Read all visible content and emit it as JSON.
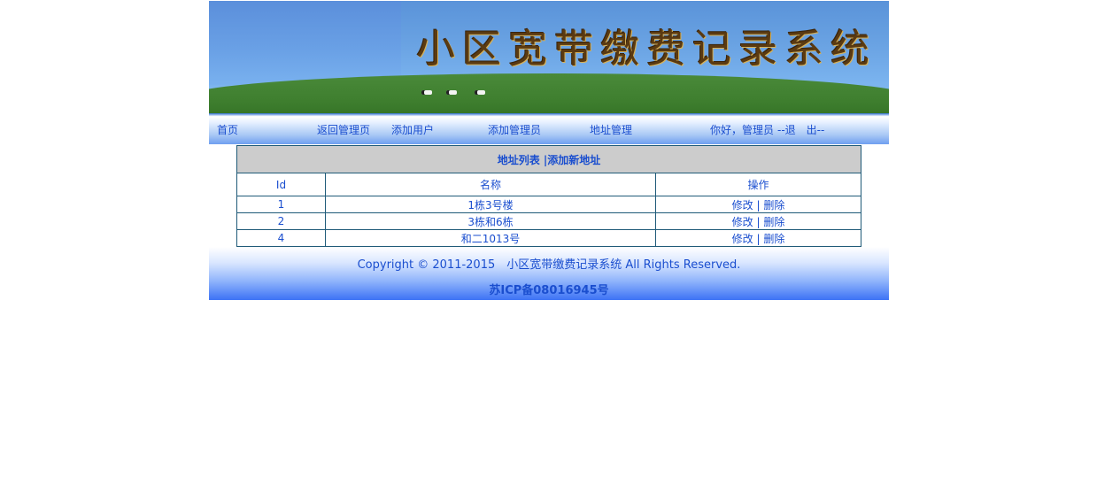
{
  "banner": {
    "title": "小区宽带缴费记录系统"
  },
  "nav": {
    "home": "首页",
    "back_admin": "返回管理页",
    "add_user": "添加用户",
    "add_admin": "添加管理员",
    "address_mgmt": "地址管理",
    "greeting": "你好，管理员",
    "logout": "--退　出--"
  },
  "table": {
    "caption_list": "地址列表",
    "caption_sep": "|",
    "caption_add": "添加新地址",
    "headers": {
      "id": "Id",
      "name": "名称",
      "action": "操作"
    },
    "rows": [
      {
        "id": "1",
        "name": "1栋3号楼",
        "edit": "修改",
        "sep": "|",
        "delete": "删除"
      },
      {
        "id": "2",
        "name": "3栋和6栋",
        "edit": "修改",
        "sep": "|",
        "delete": "删除"
      },
      {
        "id": "4",
        "name": "和二1013号",
        "edit": "修改",
        "sep": "|",
        "delete": "删除"
      }
    ]
  },
  "footer": {
    "copyright": "Copyright © 2011-2015　小区宽带缴费记录系统 All Rights Reserved.",
    "icp": "苏ICP备08016945号"
  }
}
